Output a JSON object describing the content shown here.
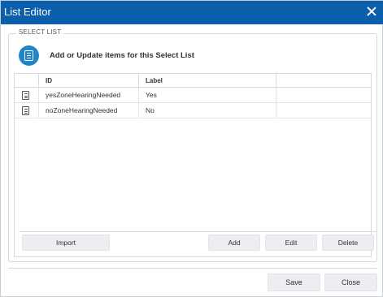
{
  "window": {
    "title": "List Editor",
    "close_icon": "close-icon"
  },
  "select_list": {
    "legend": "SELECT LIST",
    "header_icon": "list-document-icon",
    "header_text": "Add or Update items for this Select List",
    "columns": [
      "",
      "ID",
      "Label",
      ""
    ],
    "rows": [
      {
        "icon": "document-icon",
        "id": "yesZoneHearingNeeded",
        "label": "Yes"
      },
      {
        "icon": "document-icon",
        "id": "noZoneHearingNeeded",
        "label": "No"
      }
    ],
    "toolbar": {
      "import_label": "Import",
      "add_label": "Add",
      "edit_label": "Edit",
      "delete_label": "Delete"
    }
  },
  "footer": {
    "save_label": "Save",
    "close_label": "Close"
  },
  "colors": {
    "titlebar": "#0c5fac",
    "accent_icon": "#2184c6",
    "button_bg": "#eceef1"
  }
}
